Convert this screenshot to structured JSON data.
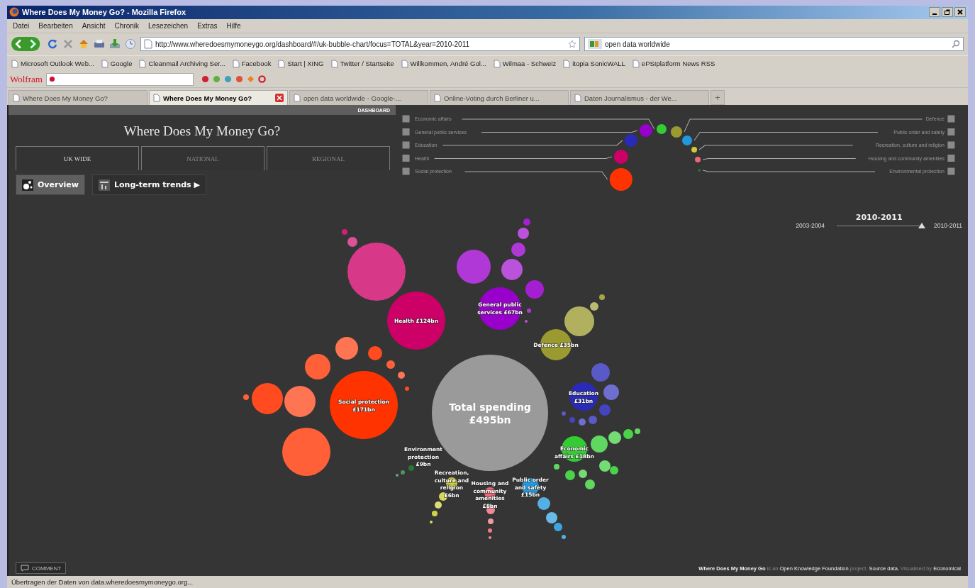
{
  "window": {
    "title": "Where Does My Money Go? - Mozilla Firefox"
  },
  "menu": [
    "Datei",
    "Bearbeiten",
    "Ansicht",
    "Chronik",
    "Lesezeichen",
    "Extras",
    "Hilfe"
  ],
  "address": {
    "url": "http://www.wheredoesmymoneygo.org/dashboard/#/uk-bubble-chart/focus=TOTAL&year=2010-2011"
  },
  "search": {
    "value": "open data worldwide"
  },
  "bookmarks": [
    "Microsoft Outlook Web...",
    "Google",
    "Cleanmail Archiving Ser...",
    "Facebook",
    "Start | XING",
    "Twitter / Startseite",
    "Willkommen, André Gol...",
    "Wilmaa - Schweiz",
    "itopia SonicWALL",
    "ePSIplatform News RSS"
  ],
  "wolfram": {
    "logo": "Wolfram"
  },
  "tabs": [
    {
      "label": "Where Does My Money Go?",
      "selected": false
    },
    {
      "label": "Where Does My Money Go?",
      "selected": true
    },
    {
      "label": "open data worldwide - Google-...",
      "selected": false
    },
    {
      "label": "Online-Voting durch Berliner u...",
      "selected": false
    },
    {
      "label": "Daten Journalismus - der We...",
      "selected": false
    }
  ],
  "new_tab": "+",
  "dashboard": {
    "tag": "DASHBOARD",
    "title": "Where Does My Money Go?",
    "views": [
      {
        "label": "UK WIDE",
        "selected": true
      },
      {
        "label": "NATIONAL",
        "selected": false
      },
      {
        "label": "REGIONAL",
        "selected": false
      }
    ],
    "modes": [
      {
        "label": "Overview",
        "selected": true
      },
      {
        "label": "Long-term trends ▶",
        "selected": false
      }
    ]
  },
  "categories": [
    {
      "name": "Economic affairs",
      "color": "#33cc33",
      "checked": true,
      "label": [
        "Economic",
        "affairs £18bn"
      ]
    },
    {
      "name": "General public services",
      "color": "#9900cc",
      "checked": true,
      "label": [
        "General public",
        "services £67bn"
      ]
    },
    {
      "name": "Education",
      "color": "#2a2ab8",
      "checked": true,
      "label": [
        "Education",
        "£31bn"
      ]
    },
    {
      "name": "Health",
      "color": "#cc0066",
      "checked": true,
      "label": [
        "Health £124bn"
      ]
    },
    {
      "name": "Social protection",
      "color": "#ff3300",
      "checked": true,
      "label": [
        "Social protection",
        "£171bn"
      ]
    },
    {
      "name": "Defence",
      "color": "#9a9a30",
      "checked": true,
      "label": [
        "Defence £35bn"
      ]
    },
    {
      "name": "Public order and safety",
      "color": "#2299dd",
      "checked": true,
      "label": [
        "Public order",
        "and safety",
        "£15bn"
      ]
    },
    {
      "name": "Recreation, culture and religion",
      "color": "#cccc33",
      "checked": true,
      "label": [
        "Recreation,",
        "culture and",
        "religion",
        "£6bn"
      ]
    },
    {
      "name": "Housing and community amenities",
      "color": "#ee6677",
      "checked": true,
      "label": [
        "Housing and",
        "community",
        "amenities",
        "£8bn"
      ]
    },
    {
      "name": "Environmental protection",
      "color": "#227733",
      "checked": true,
      "label": [
        "Environment",
        "protection",
        "£9bn"
      ]
    }
  ],
  "total": {
    "label": [
      "Total spending",
      "£495bn"
    ]
  },
  "year_slider": {
    "current": "2010-2011",
    "start": "2003-2004",
    "end": "2010-2011",
    "level": 1
  },
  "comment_button": "COMMENT",
  "credits": [
    {
      "kind": "strong",
      "text": "Where Does My Money Go"
    },
    {
      "kind": "plain",
      "text": " is an "
    },
    {
      "kind": "link",
      "text": "Open Knowledge Foundation"
    },
    {
      "kind": "plain",
      "text": " project. "
    },
    {
      "kind": "link",
      "text": "Source data."
    },
    {
      "kind": "plain",
      "text": " Visualised by "
    },
    {
      "kind": "link",
      "text": "Economical"
    }
  ],
  "status_bar": "Übertragen der Daten von data.wheredoesmymoneygo.org..."
}
